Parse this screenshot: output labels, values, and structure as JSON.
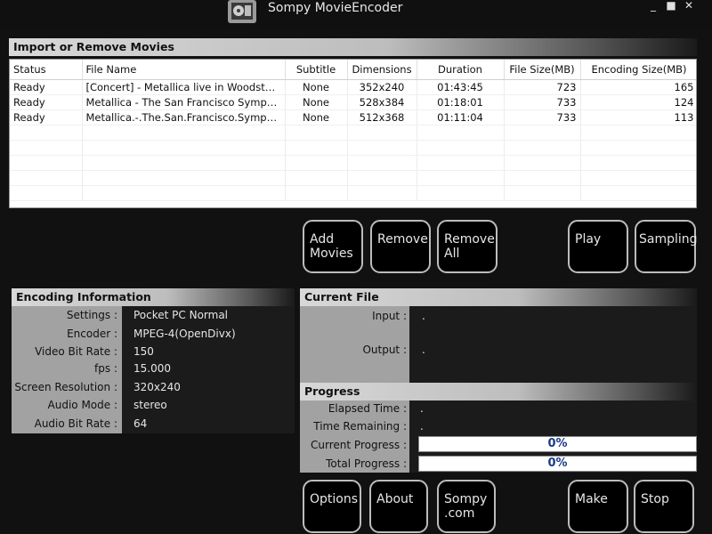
{
  "window": {
    "title": "Sompy MovieEncoder",
    "controls": [
      "_",
      "■",
      "✕"
    ]
  },
  "import_section": {
    "header": "Import or Remove Movies",
    "columns": [
      "Status",
      "File Name",
      "Subtitle",
      "Dimensions",
      "Duration",
      "File Size(MB)",
      "Encoding Size(MB)"
    ],
    "rows": [
      [
        "Ready",
        "[Concert] - Metallica live in Woodsto…",
        "None",
        "352x240",
        "01:43:45",
        "723",
        "165"
      ],
      [
        "Ready",
        "Metallica - The San Francisco Symph…",
        "None",
        "528x384",
        "01:18:01",
        "733",
        "124"
      ],
      [
        "Ready",
        "Metallica.-.The.San.Francisco.Symp…",
        "None",
        "512x368",
        "01:11:04",
        "733",
        "113"
      ]
    ]
  },
  "action_buttons": {
    "add_movies": [
      "Add",
      "Movies"
    ],
    "remove": "Remove",
    "remove_all": [
      "Remove",
      "All"
    ],
    "play": "Play",
    "sampling": "Sampling"
  },
  "encoding_info": {
    "header": "Encoding Information",
    "fields": [
      {
        "label": "Settings :",
        "value": "Pocket PC Normal"
      },
      {
        "label": "Encoder :",
        "value": "MPEG-4(OpenDivx)"
      },
      {
        "label": "Video Bit Rate :",
        "value": "150"
      },
      {
        "label": "fps :",
        "value": "15.000"
      },
      {
        "label": "Screen Resolution :",
        "value": "320x240"
      },
      {
        "label": "Audio Mode :",
        "value": "stereo"
      },
      {
        "label": "Audio Bit Rate :",
        "value": "64"
      }
    ]
  },
  "current_file": {
    "header": "Current File",
    "input_label": "Input :",
    "input_value": ".",
    "output_label": "Output :",
    "output_value": "."
  },
  "progress": {
    "header": "Progress",
    "elapsed_label": "Elapsed Time :",
    "elapsed_value": ".",
    "remaining_label": "Time Remaining :",
    "remaining_value": ".",
    "current_label": "Current Progress :",
    "current_percent": "0%",
    "current_fraction": 0,
    "total_label": "Total Progress :",
    "total_percent": "0%",
    "total_fraction": 0
  },
  "bottom_buttons": {
    "options": "Options",
    "about": "About",
    "sompy": [
      "Sompy",
      ".com"
    ],
    "make": "Make",
    "stop": "Stop"
  },
  "colors": {
    "background": "#111111",
    "panel_grey": "#a2a2a2",
    "progress_text": "#1b3a8a"
  }
}
